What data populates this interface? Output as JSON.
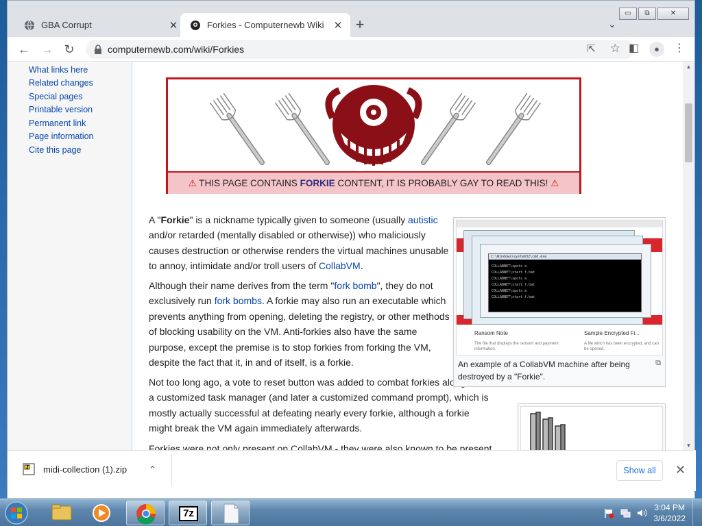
{
  "browser": {
    "tabs": [
      {
        "title": "GBA Corrupt",
        "close": "✕"
      },
      {
        "title": "Forkies - Computernewb Wiki",
        "close": "✕"
      }
    ],
    "new_tab": "+",
    "tab_dropdown": "⌄",
    "window_buttons": {
      "minimize": "▭",
      "restore": "⧉",
      "close": "✕"
    },
    "nav": {
      "back": "←",
      "forward": "→",
      "reload": "↻"
    },
    "url": "computernewb.com/wiki/Forkies",
    "share": "⇱",
    "star": "☆",
    "side_panel": "◧",
    "profile": "●",
    "menu": "⋮"
  },
  "sidebar": {
    "links": [
      "What links here",
      "Related changes",
      "Special pages",
      "Printable version",
      "Permanent link",
      "Page information",
      "Cite this page"
    ]
  },
  "banner": {
    "before": "THIS PAGE CONTAINS ",
    "bold": "FORKIE",
    "after": " CONTENT, IT IS PROBABLY GAY TO READ THIS!",
    "warn_icon": "⚠"
  },
  "article": {
    "p1": {
      "a": "A \"",
      "forkie": "Forkie",
      "b": "\" is a nickname typically given to someone (usually ",
      "link_autistic": "autistic",
      "c": " and/or retarded (mentally disabled or otherwise)) who maliciously causes destruction or otherwise renders the virtual machines unusable to annoy, intimidate and/or troll users of ",
      "link_collabvm": "CollabVM",
      "d": "."
    },
    "p2": {
      "a": "Although their name derives from the term \"",
      "link_forkbomb": "fork bomb",
      "b": "\", they do not exclusively run ",
      "link_forkbombs": "fork bombs",
      "c": ". A forkie may also run an executable which prevents anything from opening, deleting the registry, or other methods of blocking usability on the VM. Anti-forkies also have the same purpose, except the premise is to stop forkies from forking the VM, despite the fact that it, in and of itself, is a forkie."
    },
    "p3": "Not too long ago, a vote to reset button was added to combat forkies along with a customized task manager (and later a customized command prompt), which is mostly actually successful at defeating nearly every forkie, although a forkie might break the VM again immediately afterwards.",
    "p4": "Forkies were not only present on CollabVM - they were also known to be present"
  },
  "thumbnail": {
    "caption": "An example of a CollabVM machine after being destroyed by a \"Forkie\".",
    "magnify": "⧉",
    "inner_labels": [
      "Ransom Note",
      "Sample Encrypted Fi..."
    ],
    "inner_desc": [
      "The file that displays the ransom and payment information.",
      "A file which has been encrypted, and can be opened."
    ],
    "cmd_lines": [
      "C:\\Windows\\system32\\cmd.exe",
      "COLLABNET\\spots a",
      "COLLABNET\\start f.bat"
    ]
  },
  "downloads": {
    "file": "midi-collection (1).zip",
    "chevron": "⌃",
    "show_all": "Show all",
    "close": "✕"
  },
  "taskbar": {
    "time": "3:04 PM",
    "date": "3/6/2022",
    "app_7z": "7z"
  },
  "colors": {
    "banner_border": "#c0171e",
    "banner_strip": "#f5c4c8",
    "link": "#0645ad",
    "download_link": "#1a73e8"
  }
}
